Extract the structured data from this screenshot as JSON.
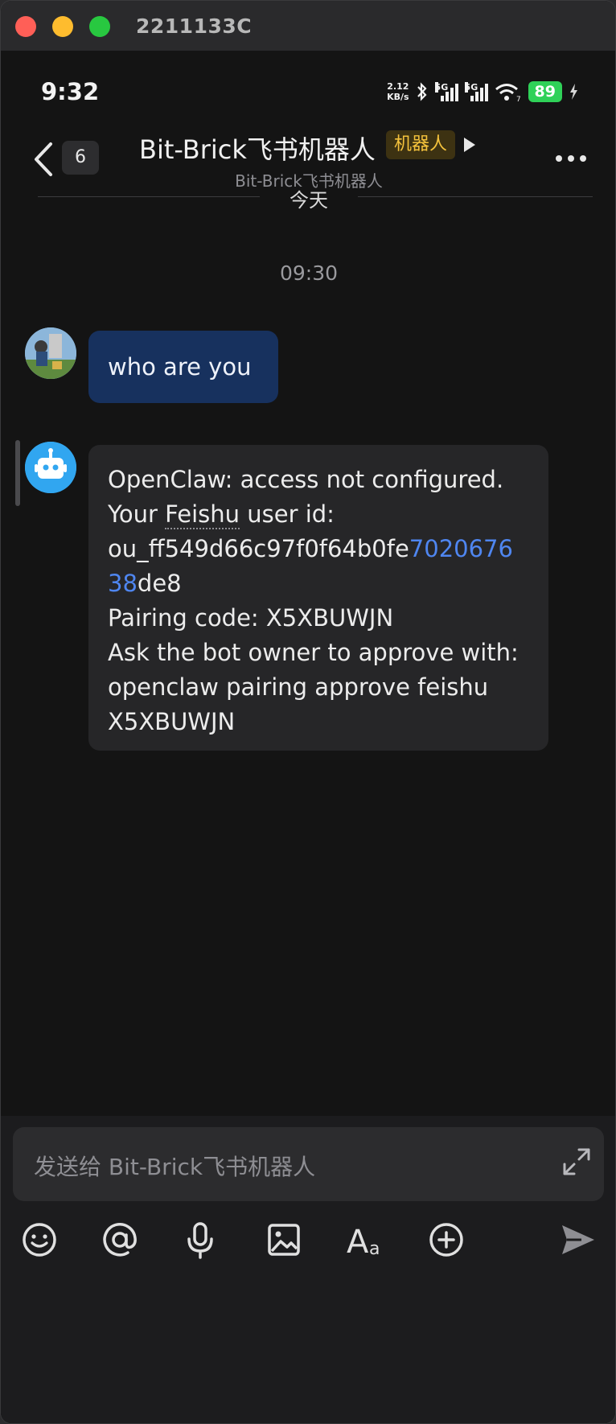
{
  "window": {
    "title": "2211133C"
  },
  "status_bar": {
    "time": "9:32",
    "net_speed_value": "2.12",
    "net_speed_unit": "KB/s",
    "sim1_label": "5G",
    "sim2_label": "5G",
    "wifi_label": "7",
    "battery": "89"
  },
  "header": {
    "back_badge": "6",
    "title": "Bit-Brick飞书机器人",
    "tag": "机器人",
    "subtitle": "Bit-Brick飞书机器人"
  },
  "chat": {
    "date_divider": "今天",
    "timestamp": "09:30",
    "messages": [
      {
        "sender": "user",
        "text": "who are you"
      },
      {
        "sender": "bot",
        "lines": {
          "l1": "OpenClaw: access not configured.",
          "l2_a": "Your ",
          "l2_b": "Feishu",
          "l2_c": " user id:",
          "l3_a": "ou_ff549d66c97f0f64b0fe",
          "l3_b": "7020676",
          "l4_a": "38",
          "l4_b": "de8",
          "l5": "Pairing code: X5XBUWJN",
          "l6": "Ask the bot owner to approve with:",
          "l7": "openclaw pairing approve feishu",
          "l8": "X5XBUWJN"
        }
      }
    ]
  },
  "composer": {
    "placeholder": "发送给 Bit-Brick飞书机器人",
    "tools": [
      "emoji-icon",
      "mention-icon",
      "microphone-icon",
      "image-icon",
      "text-format-icon",
      "plus-icon",
      "send-icon"
    ],
    "format_label": "A",
    "format_sub": "a"
  },
  "colors": {
    "user_bubble": "#17315e",
    "bot_bubble": "#262628",
    "link": "#4f86f0",
    "tag_text": "#f4c23c",
    "battery": "#2fd158"
  }
}
